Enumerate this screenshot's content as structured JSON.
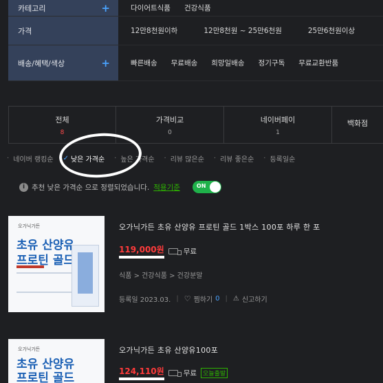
{
  "filters": [
    {
      "label": "카테고리",
      "options": [
        "다이어트식품",
        "건강식품"
      ]
    },
    {
      "label": "가격",
      "options": [
        "12만8천원이하",
        "12만8천원 ~ 25만6천원",
        "25만6천원이상"
      ]
    },
    {
      "label": "배송/혜택/색상",
      "options": [
        "빠른배송",
        "무료배송",
        "희망일배송",
        "정기구독",
        "무료교환반품"
      ]
    }
  ],
  "tabs": [
    {
      "label": "전체",
      "count": "8"
    },
    {
      "label": "가격비교",
      "count": "0"
    },
    {
      "label": "네이버페이",
      "count": "1"
    },
    {
      "label": "백화점",
      "count": ""
    }
  ],
  "sort": {
    "items": [
      "네이버 랭킹순",
      "낮은 가격순",
      "높은 가격순",
      "리뷰 많은순",
      "리뷰 좋은순",
      "등록일순"
    ],
    "active_index": 1
  },
  "notice": {
    "text": "추천 낮은 가격순 으로 정렬되었습니다.",
    "link": "적용기준",
    "toggle": "ON"
  },
  "products": [
    {
      "title": "오가닉가든 초유 산양유 프로틴 골드 1박스 100포 하루 한 포",
      "price": "119,000원",
      "shipping": "무료",
      "category": "식품 > 건강식품 > 건강분말",
      "registered": "등록일 2023.03.",
      "wish_label": "찜하기",
      "wish_count": "0",
      "report": "신고하기",
      "thumb_brand": "오가닉가든",
      "thumb_line1": "초유 산양유",
      "thumb_line2": "프로틴 골드"
    },
    {
      "title": "오가닉가든 초유 산양유100포",
      "price": "124,110원",
      "shipping": "무료",
      "badge": "오늘출발",
      "thumb_brand": "오가닉가든",
      "thumb_line1": "초유 산양유",
      "thumb_line2": "프로틴 골드"
    }
  ]
}
